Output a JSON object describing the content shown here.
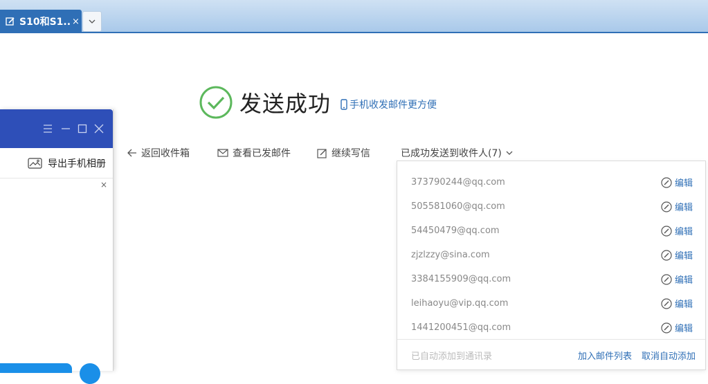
{
  "tab": {
    "title": "S10和S1...",
    "close": "×",
    "dropdown_icon": "chevron-down-icon"
  },
  "result": {
    "title": "发送成功",
    "phone_link": "手机收发邮件更方便"
  },
  "actions": {
    "back": "返回收件箱",
    "view_sent": "查看已发邮件",
    "continue": "继续写信",
    "sent_to": "已成功发送到收件人(7)"
  },
  "recipients": [
    {
      "email": "373790244@qq.com",
      "edit": "编辑"
    },
    {
      "email": "505581060@qq.com",
      "edit": "编辑"
    },
    {
      "email": "54450479@qq.com",
      "edit": "编辑"
    },
    {
      "email": "zjzlzzy@sina.com",
      "edit": "编辑"
    },
    {
      "email": "3384155909@qq.com",
      "edit": "编辑"
    },
    {
      "email": "leihaoyu@vip.qq.com",
      "edit": "编辑"
    },
    {
      "email": "1441200451@qq.com",
      "edit": "编辑"
    }
  ],
  "footer": {
    "note": "已自动添加到通讯录",
    "add_to_list": "加入邮件列表",
    "cancel_auto": "取消自动添加"
  },
  "side_window": {
    "export": "导出手机相册",
    "close": "×"
  },
  "colors": {
    "accent": "#2f6fb6",
    "success": "#5cb85c",
    "side_title": "#2e4fb8"
  }
}
